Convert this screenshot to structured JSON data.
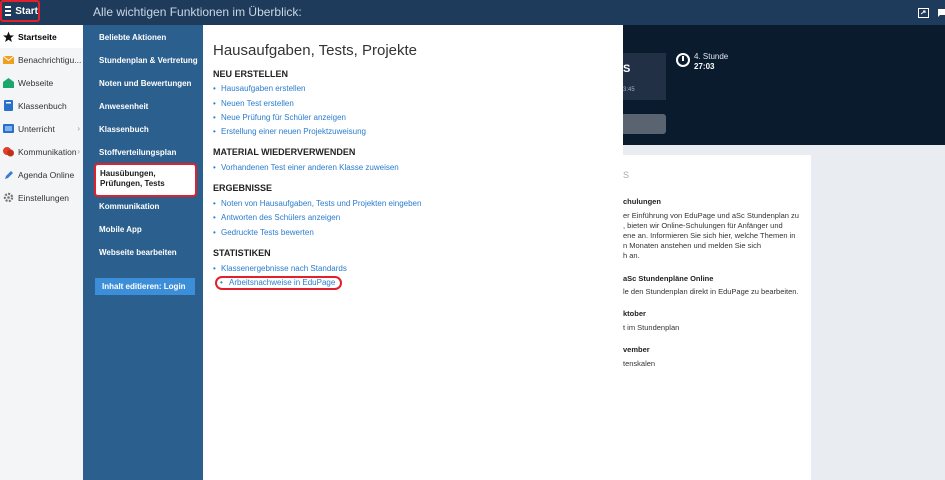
{
  "topbar": {
    "start_label": "Start",
    "title": "Alle wichtigen Funktionen im Überblick:"
  },
  "sidebar": {
    "items": [
      {
        "label": "Startseite",
        "icon": "star-icon",
        "active": true
      },
      {
        "label": "Benachrichtigu...",
        "icon": "mail-icon"
      },
      {
        "label": "Webseite",
        "icon": "website-icon"
      },
      {
        "label": "Klassenbuch",
        "icon": "book-icon"
      },
      {
        "label": "Unterricht",
        "icon": "class-icon",
        "arrow": true
      },
      {
        "label": "Kommunikation",
        "icon": "chat-icon",
        "arrow": true
      },
      {
        "label": "Agenda Online",
        "icon": "pencil-icon"
      },
      {
        "label": "Einstellungen",
        "icon": "gear-icon"
      }
    ]
  },
  "menu": {
    "items": [
      "Beliebte Aktionen",
      "Stundenplan & Vertretung",
      "Noten und Bewertungen",
      "Anwesenheit",
      "Klassenbuch",
      "Stoffverteilungsplan",
      "Hausübungen, Prüfungen, Tests",
      "Kommunikation",
      "Mobile App",
      "Webseite bearbeiten"
    ],
    "edit_button": "Inhalt editieren: Login"
  },
  "panel": {
    "title": "Hausaufgaben, Tests, Projekte",
    "sections": [
      {
        "heading": "NEU ERSTELLEN",
        "links": [
          "Hausaufgaben erstellen",
          "Neuen Test erstellen",
          "Neue Prüfung für Schüler anzeigen",
          "Erstellung einer neuen Projektzuweisung"
        ]
      },
      {
        "heading": "MATERIAL WIEDERVERWENDEN",
        "links": [
          "Vorhandenen Test einer anderen Klasse zuweisen"
        ]
      },
      {
        "heading": "ERGEBNISSE",
        "links": [
          "Noten von Hausaufgaben, Tests und Projekten eingeben",
          "Antworten des Schülers anzeigen",
          "Gedruckte Tests bewerten"
        ]
      },
      {
        "heading": "STATISTIKEN",
        "links": [
          "Klassenergebnisse nach Standards",
          "Arbeitsnachweise in EduPage"
        ]
      }
    ]
  },
  "background": {
    "tile_big": "S",
    "tile_small": "3:45",
    "period_label": "4. Stunde",
    "period_time": "27:03",
    "card_lines": [
      {
        "text": "S",
        "style": "g"
      },
      {
        "text": "chulungen",
        "style": "b"
      },
      {
        "text": "er Einführung von EduPage und aSc Stundenplan zu"
      },
      {
        "text": ", bieten wir Online-Schulungen für Anfänger und"
      },
      {
        "text": "ene an. Informieren Sie sich hier, welche Themen in"
      },
      {
        "text": "n Monaten anstehen und melden Sie sich"
      },
      {
        "text": "h an."
      },
      {
        "text": "aSc Stundenpläne Online",
        "style": "b"
      },
      {
        "text": "le den Stundenplan direkt in EduPage zu bearbeiten."
      },
      {
        "text": "ktober",
        "style": "b"
      },
      {
        "text": "t im Stundenplan"
      },
      {
        "text": "vember",
        "style": "b"
      },
      {
        "text": "tenskalen"
      }
    ]
  },
  "colors": {
    "topbar": "#1f3b5c",
    "menu": "#2b5f8e",
    "link": "#2a7ccf",
    "highlight": "#e0202a"
  }
}
